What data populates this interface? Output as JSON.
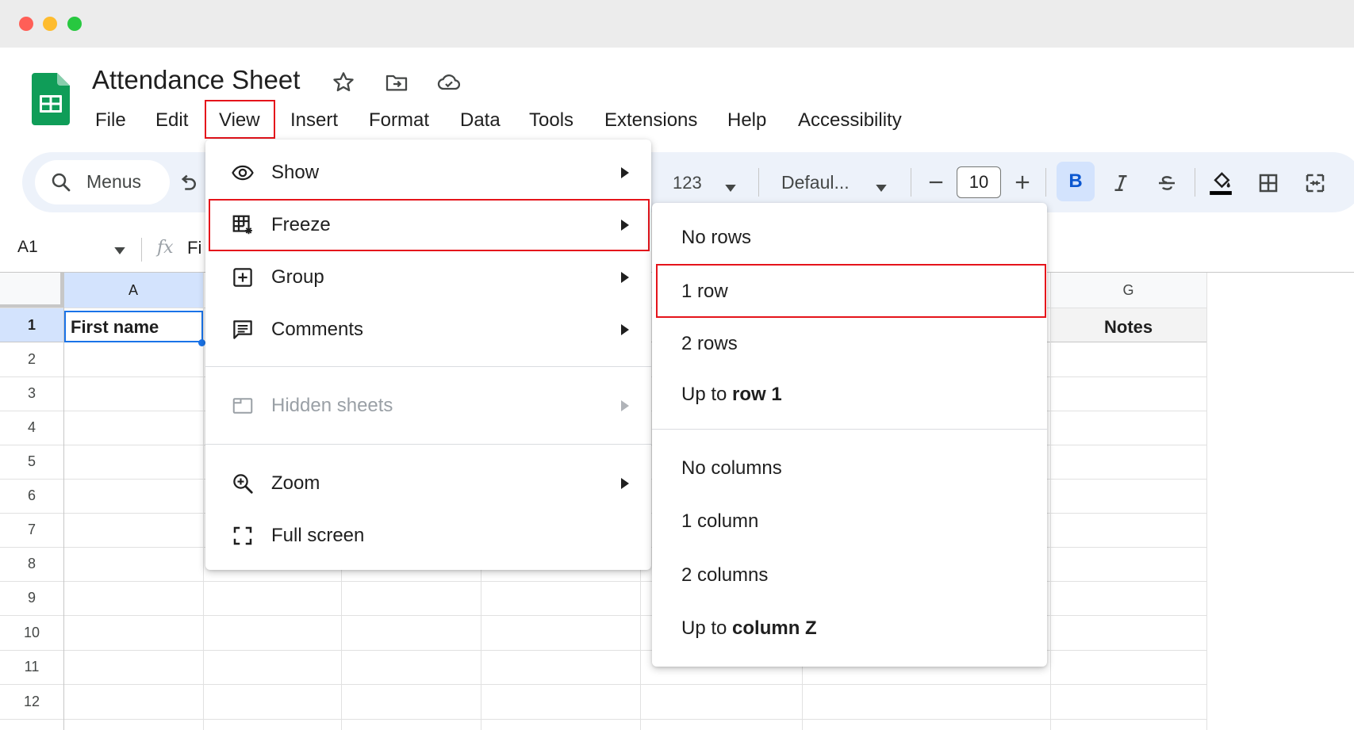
{
  "window": {
    "controls": [
      "close",
      "minimize",
      "zoom"
    ]
  },
  "header": {
    "title": "Attendance Sheet",
    "icons": [
      "star-icon",
      "move-to-folder-icon",
      "cloud-saved-icon"
    ]
  },
  "menubar": {
    "items": [
      "File",
      "Edit",
      "View",
      "Insert",
      "Format",
      "Data",
      "Tools",
      "Extensions",
      "Help",
      "Accessibility"
    ]
  },
  "toolbar": {
    "search_label": "Menus",
    "number_format": "123",
    "font_family": "Defaul...",
    "font_size": "10",
    "bold": "B"
  },
  "formula_bar": {
    "name_box": "A1",
    "fx": "fx",
    "content": "Fi"
  },
  "grid": {
    "columns": [
      "A",
      "G"
    ],
    "rows": [
      "1",
      "2",
      "3",
      "4",
      "5",
      "6",
      "7",
      "8",
      "9",
      "10",
      "11",
      "12"
    ],
    "cells": {
      "A1": "First name",
      "G1": "Notes"
    }
  },
  "view_menu": {
    "items": [
      {
        "label": "Show",
        "icon": "eye-icon"
      },
      {
        "label": "Freeze",
        "icon": "freeze-grid-icon"
      },
      {
        "label": "Group",
        "icon": "plus-box-icon"
      },
      {
        "label": "Comments",
        "icon": "comment-icon"
      },
      {
        "label": "Hidden sheets",
        "icon": "hidden-sheet-icon"
      },
      {
        "label": "Zoom",
        "icon": "zoom-in-icon"
      },
      {
        "label": "Full screen",
        "icon": "fullscreen-icon"
      }
    ]
  },
  "freeze_submenu": {
    "no_rows": "No rows",
    "one_row": "1 row",
    "two_rows": "2 rows",
    "up_to_row_prefix": "Up to ",
    "up_to_row_bold": "row 1",
    "no_columns": "No columns",
    "one_column": "1 column",
    "two_columns": "2 columns",
    "up_to_col_prefix": "Up to ",
    "up_to_col_bold": "column Z"
  },
  "colors": {
    "highlight": "#e5141b",
    "accent": "#0b57d0",
    "sheets_green": "#0f9d58"
  }
}
